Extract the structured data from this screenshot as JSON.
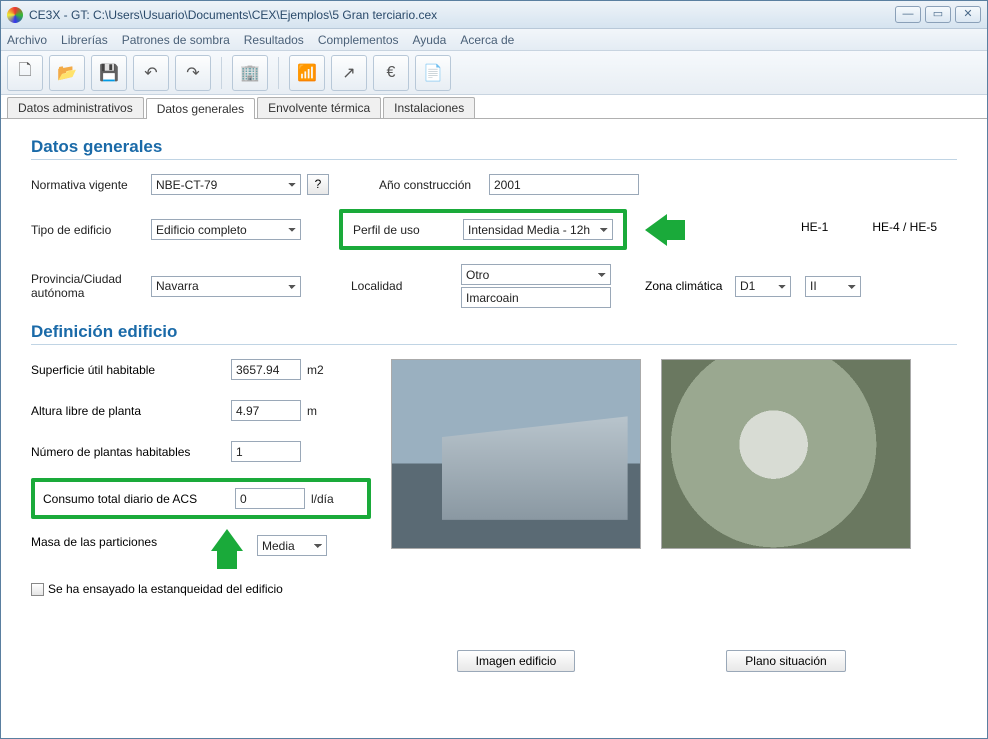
{
  "window": {
    "title": "CE3X - GT: C:\\Users\\Usuario\\Documents\\CEX\\Ejemplos\\5 Gran terciario.cex"
  },
  "menu": [
    "Archivo",
    "Librerías",
    "Patrones de sombra",
    "Resultados",
    "Complementos",
    "Ayuda",
    "Acerca de"
  ],
  "tabs": [
    "Datos administrativos",
    "Datos generales",
    "Envolvente térmica",
    "Instalaciones"
  ],
  "active_tab": 1,
  "section1": {
    "title": "Datos generales",
    "normativa_label": "Normativa vigente",
    "normativa_value": "NBE-CT-79",
    "help": "?",
    "ano_label": "Año construcción",
    "ano_value": "2001",
    "tipo_label": "Tipo de edificio",
    "tipo_value": "Edificio completo",
    "perfil_label": "Perfil de uso",
    "perfil_value": "Intensidad Media - 12h",
    "zone_he1": "HE-1",
    "zone_he45": "HE-4 / HE-5",
    "provincia_label": "Provincia/Ciudad autónoma",
    "provincia_value": "Navarra",
    "localidad_label": "Localidad",
    "localidad_value": "Otro",
    "localidad_text": "Imarcoain",
    "zona_label": "Zona climática",
    "zona_he1_value": "D1",
    "zona_he45_value": "II"
  },
  "section2": {
    "title": "Definición edificio",
    "superficie_label": "Superficie útil habitable",
    "superficie_value": "3657.94",
    "superficie_unit": "m2",
    "altura_label": "Altura libre de planta",
    "altura_value": "4.97",
    "altura_unit": "m",
    "plantas_label": "Número de plantas habitables",
    "plantas_value": "1",
    "acs_label": "Consumo total diario de ACS",
    "acs_value": "0",
    "acs_unit": "l/día",
    "masa_label": "Masa de las particiones",
    "masa_value": "Media",
    "ensayo_label": "Se ha ensayado la estanqueidad del edificio",
    "btn_imagen": "Imagen edificio",
    "btn_plano": "Plano situación"
  }
}
